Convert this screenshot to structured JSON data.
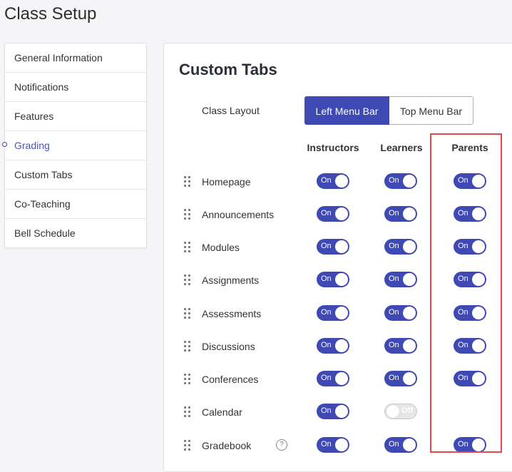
{
  "page": {
    "title": "Class Setup"
  },
  "sidebar": {
    "items": [
      {
        "label": "General Information",
        "active": false
      },
      {
        "label": "Notifications",
        "active": false
      },
      {
        "label": "Features",
        "active": false
      },
      {
        "label": "Grading",
        "active": true
      },
      {
        "label": "Custom Tabs",
        "active": false
      },
      {
        "label": "Co-Teaching",
        "active": false
      },
      {
        "label": "Bell Schedule",
        "active": false
      }
    ]
  },
  "main": {
    "title": "Custom Tabs",
    "layout": {
      "label": "Class Layout",
      "options": [
        "Left Menu Bar",
        "Top Menu Bar"
      ],
      "selected": "Left Menu Bar"
    },
    "columns": [
      "Instructors",
      "Learners",
      "Parents"
    ],
    "rows": [
      {
        "label": "Homepage",
        "instructors": "On",
        "learners": "On",
        "parents": "On"
      },
      {
        "label": "Announcements",
        "instructors": "On",
        "learners": "On",
        "parents": "On"
      },
      {
        "label": "Modules",
        "instructors": "On",
        "learners": "On",
        "parents": "On"
      },
      {
        "label": "Assignments",
        "instructors": "On",
        "learners": "On",
        "parents": "On"
      },
      {
        "label": "Assessments",
        "instructors": "On",
        "learners": "On",
        "parents": "On"
      },
      {
        "label": "Discussions",
        "instructors": "On",
        "learners": "On",
        "parents": "On"
      },
      {
        "label": "Conferences",
        "instructors": "On",
        "learners": "On",
        "parents": "On"
      },
      {
        "label": "Calendar",
        "instructors": "On",
        "learners": "Off",
        "parents": null
      },
      {
        "label": "Gradebook",
        "instructors": "On",
        "learners": "On",
        "parents": "On",
        "help": "?"
      }
    ]
  },
  "colors": {
    "accent": "#3f49b4",
    "highlight": "#e5474b"
  },
  "icons": {
    "drag": "drag-handle-icon",
    "help": "question-circle-icon"
  }
}
